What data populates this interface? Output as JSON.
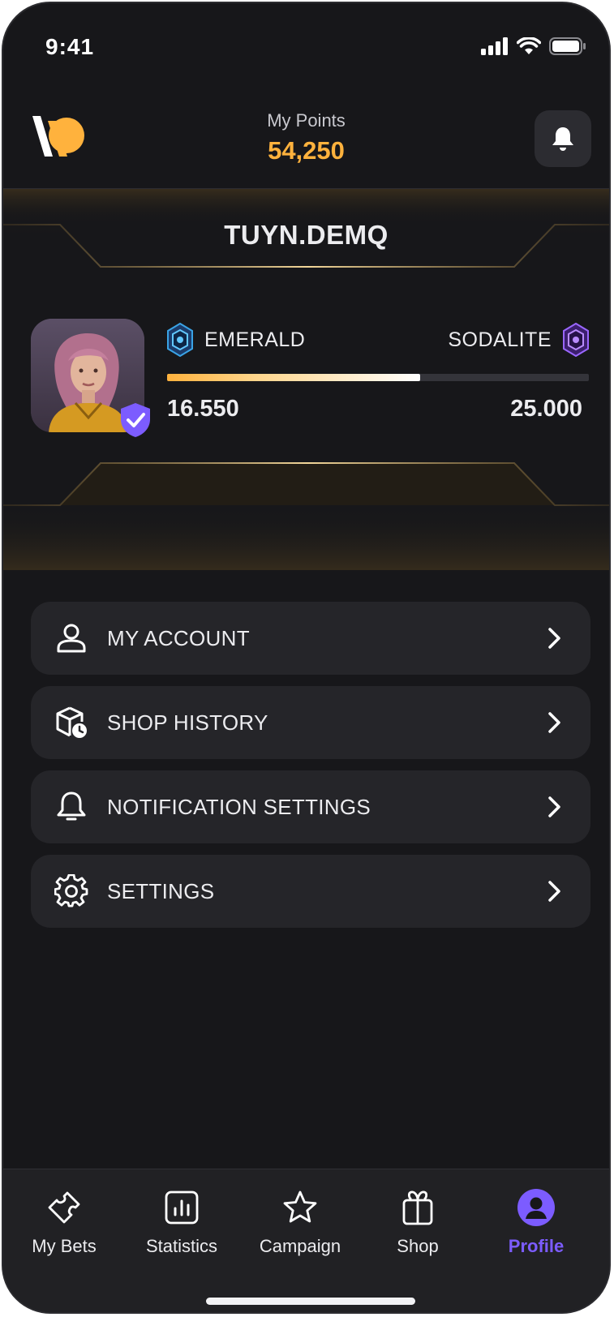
{
  "status_bar": {
    "time": "9:41"
  },
  "header": {
    "points_label": "My Points",
    "points_value": "54,250"
  },
  "profile": {
    "username": "TUYN.DEMQ",
    "current_rank": "EMERALD",
    "next_rank": "SODALITE",
    "current_points": "16.550",
    "target_points": "25.000",
    "progress_percent": 60
  },
  "menu": {
    "items": [
      {
        "label": "MY ACCOUNT",
        "icon": "user-icon"
      },
      {
        "label": "SHOP HISTORY",
        "icon": "package-clock-icon"
      },
      {
        "label": "NOTIFICATION SETTINGS",
        "icon": "bell-icon"
      },
      {
        "label": "SETTINGS",
        "icon": "gear-icon"
      }
    ]
  },
  "tabbar": {
    "tabs": [
      {
        "label": "My Bets",
        "icon": "ticket-icon"
      },
      {
        "label": "Statistics",
        "icon": "chart-icon"
      },
      {
        "label": "Campaign",
        "icon": "star-icon"
      },
      {
        "label": "Shop",
        "icon": "gift-icon"
      },
      {
        "label": "Profile",
        "icon": "profile-icon",
        "active": true
      }
    ]
  },
  "colors": {
    "accent_gold": "#ffb23d",
    "accent_purple": "#7c5cff",
    "background": "#17171a",
    "card": "#252529"
  }
}
